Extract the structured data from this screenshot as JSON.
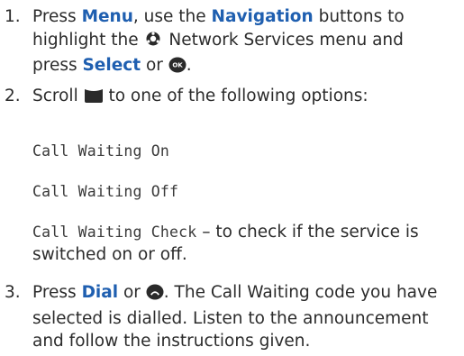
{
  "steps": [
    {
      "number": "1.",
      "l1_a": "Press ",
      "menu": "Menu",
      "l1_b": ", use the ",
      "navigation": "Navigation",
      "l1_c": " buttons to",
      "l2_a": "highlight the ",
      "l2_b": " Network Services menu and",
      "l3_a": "press ",
      "select": "Select",
      "l3_b": " or ",
      "l3_c": "."
    },
    {
      "number": "2.",
      "l1_a": "Scroll ",
      "l1_b": " to one of the following options:",
      "option_on": "Call Waiting On",
      "option_off": "Call Waiting Off",
      "option_check": "Call Waiting Check",
      "check_suffix": " – to check if the service is",
      "check_line2": "switched on or off."
    },
    {
      "number": "3.",
      "l1_a": "Press ",
      "dial": "Dial",
      "l1_b": " or ",
      "l1_c": ". The Call Waiting code you have",
      "l2": "selected is dialled. Listen to the announcement",
      "l3": "and follow the instructions given."
    }
  ],
  "icons": {
    "network": "network-services-icon",
    "ok": "ok-select-icon",
    "scroll": "scroll-key-icon",
    "dial": "dial-button-icon"
  },
  "colors": {
    "text": "#2b2b2b",
    "keyword": "#1f5fb0",
    "icon": "#2a2a2a"
  }
}
